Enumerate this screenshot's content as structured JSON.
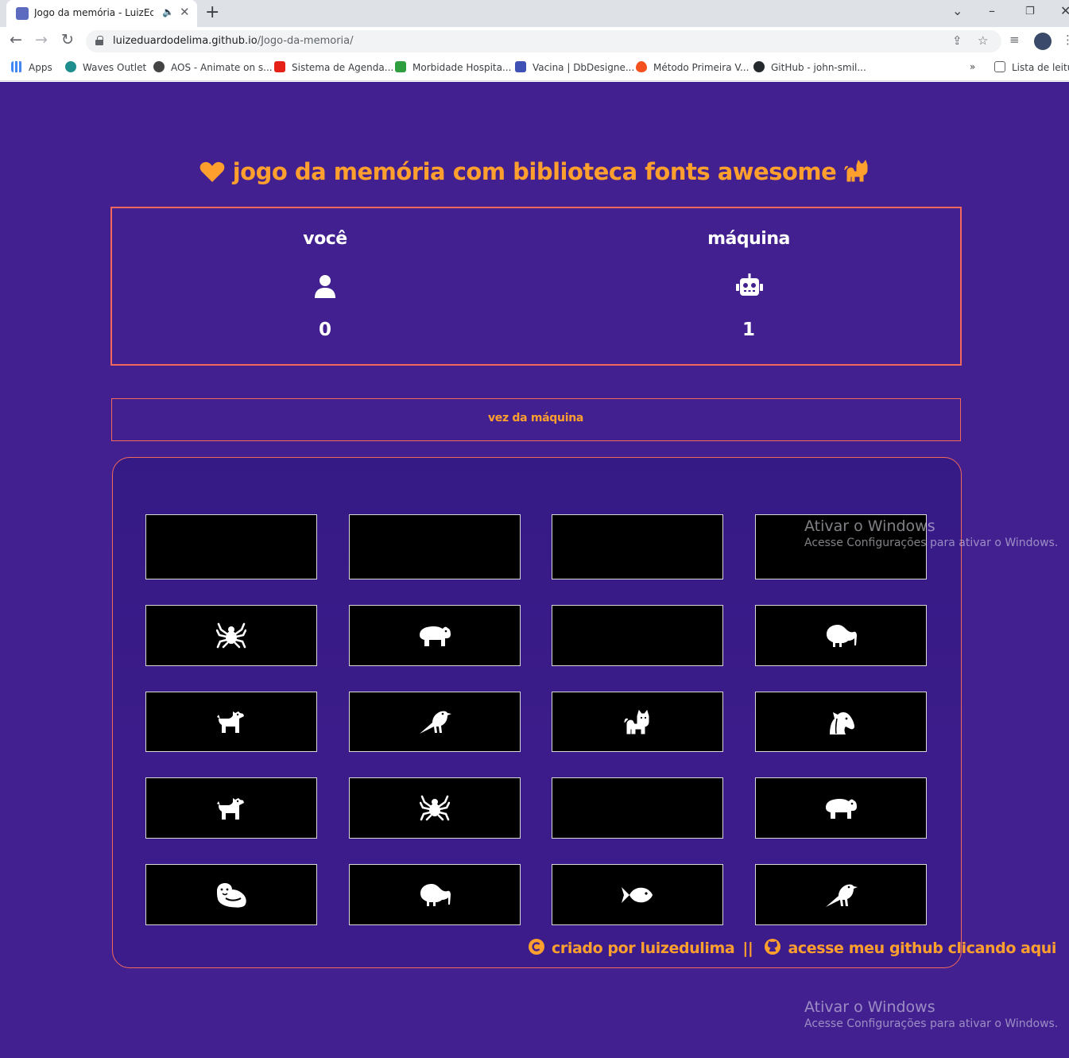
{
  "browser": {
    "tab_title": "Jogo da memória - LuizEdul...",
    "url_host": "luizeduardodelima.github.io",
    "url_path": "/Jogo-da-memoria/",
    "bookmarks": [
      {
        "label": "Apps",
        "color": "#4285f4"
      },
      {
        "label": "Waves Outlet",
        "color": "#1e8e8e"
      },
      {
        "label": "AOS - Animate on s...",
        "color": "#444444"
      },
      {
        "label": "Sistema de Agenda...",
        "color": "#e62117"
      },
      {
        "label": "Morbidade Hospita...",
        "color": "#2e9e3e"
      },
      {
        "label": "Vacina | DbDesigne...",
        "color": "#3f51b5"
      },
      {
        "label": "Método Primeira V...",
        "color": "#f4511e"
      },
      {
        "label": "GitHub - john-smil...",
        "color": "#24292e"
      }
    ],
    "reading_list": "Lista de leitura"
  },
  "game": {
    "title": "Jogo da Memória com biblioteca Fonts Awesome",
    "player": {
      "name": "Você",
      "score": "0"
    },
    "machine": {
      "name": "Máquina",
      "score": "1"
    },
    "turn": "Vez da Máquina",
    "cards": [
      {
        "icon": ""
      },
      {
        "icon": ""
      },
      {
        "icon": ""
      },
      {
        "icon": ""
      },
      {
        "icon": "spider"
      },
      {
        "icon": "hippo"
      },
      {
        "icon": ""
      },
      {
        "icon": "kiwi-bird"
      },
      {
        "icon": "dog"
      },
      {
        "icon": "crow"
      },
      {
        "icon": "cat"
      },
      {
        "icon": "horse-head"
      },
      {
        "icon": "dog"
      },
      {
        "icon": "spider"
      },
      {
        "icon": ""
      },
      {
        "icon": "hippo"
      },
      {
        "icon": "otter"
      },
      {
        "icon": "kiwi-bird"
      },
      {
        "icon": "fish"
      },
      {
        "icon": "crow"
      }
    ]
  },
  "footer": {
    "credit": "Criado por LuizEduLima",
    "separator": "||",
    "github_link": "Acesse meu github clicando aqui"
  },
  "watermark": {
    "title": "Ativar o Windows",
    "subtitle": "Acesse Configurações para ativar o Windows."
  },
  "colors": {
    "background": "#42208f",
    "accent": "#ff9f2e",
    "border": "#f2685c"
  }
}
